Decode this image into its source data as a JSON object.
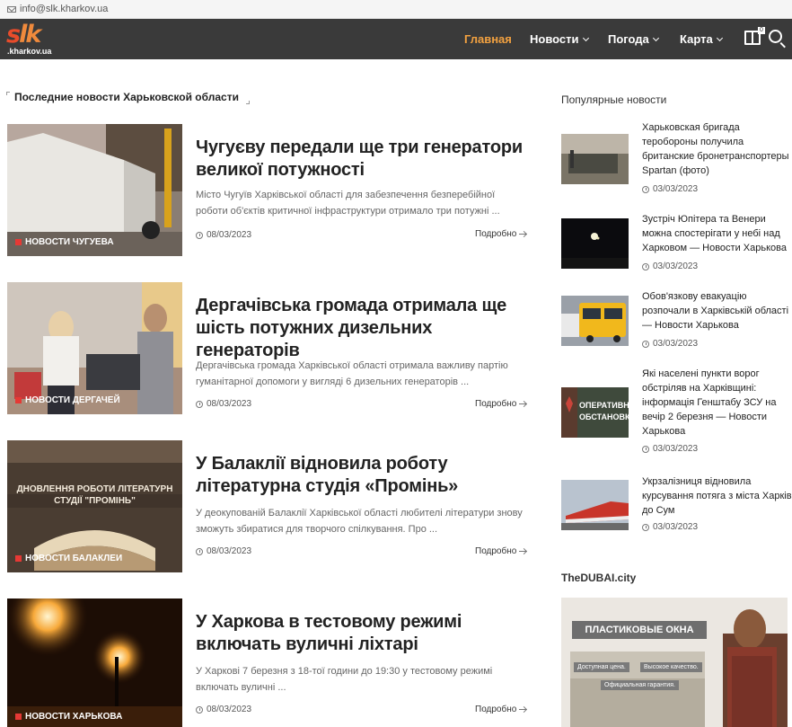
{
  "topbar": {
    "email": "info@slk.kharkov.ua"
  },
  "logo": {
    "main_a": "s",
    "main_b": "lk",
    "domain": ".kharkov.ua"
  },
  "nav": {
    "items": [
      {
        "label": "Главная",
        "active": true
      },
      {
        "label": "Новости",
        "dropdown": true
      },
      {
        "label": "Погода",
        "dropdown": true
      },
      {
        "label": "Карта",
        "dropdown": true
      }
    ],
    "bookmark_badge": "0"
  },
  "main": {
    "section_title": "Последние новости Харьковской области",
    "articles": [
      {
        "category": "НОВОСТИ ЧУГУЕВА",
        "title": "Чугуєву передали ще три генератори великої потужності",
        "excerpt": "Місто Чугуїв Харківської області для забезпечення безперебійної роботи об'єктів критичної інфраструктури отримало три потужні ...",
        "date": "08/03/2023",
        "more": "Подробно"
      },
      {
        "category": "НОВОСТИ ДЕРГАЧЕЙ",
        "title": "Дергачівська громада отримала ще шість потужних дизельних генераторів",
        "excerpt": "Дергачівська громада Харківської області отримала важливу партію гуманітарної допомоги у вигляді 6 дизельних генераторів ...",
        "date": "08/03/2023",
        "more": "Подробно"
      },
      {
        "category": "НОВОСТИ БАЛАКЛЕИ",
        "title": "У Балаклії відновила роботу літературна студія «Промінь»",
        "excerpt": "У деокупованій Балаклії Харківської області любителі літератури знову зможуть збиратися для творчого спілкування. Про ...",
        "date": "08/03/2023",
        "more": "Подробно",
        "image_text": "ДНОВЛЕННЯ РОБОТИ ЛІТЕРАТУРН СТУДІЇ \"ПРОМІНЬ\""
      },
      {
        "category": "НОВОСТИ ХАРЬКОВА",
        "title": "У Харкова в тестовому режимі включать вуличні ліхтарі",
        "excerpt": "У Харкові 7 березня з 18-тої години до 19:30 у тестовому режимі включать вуличні ...",
        "date": "08/03/2023",
        "more": "Подробно"
      }
    ]
  },
  "sidebar": {
    "popular_title": "Популярные новости",
    "popular": [
      {
        "title": "Харьковская бригада теробороны получила британские бронетранспортеры Spartan (фото)",
        "date": "03/03/2023"
      },
      {
        "title": "Зустріч Юпітера та Венери можна спостерігати у небі над Харковом — Новости Харькова",
        "date": "03/03/2023"
      },
      {
        "title": "Обов'язкову евакуацію розпочали в Харківській області — Новости Харькова",
        "date": "03/03/2023"
      },
      {
        "title": "Які населені пункти ворог обстріляв на Харківщині: інформація Генштабу ЗСУ на вечір 2 березня — Новости Харькова",
        "date": "03/03/2023",
        "image_text": "ОПЕРАТИВНА ОБСТАНОВКА"
      },
      {
        "title": "Укрзалізниця відновила курсування потяга з міста Харків до Сум",
        "date": "03/03/2023"
      }
    ],
    "dubai_title": "TheDUBAI.city",
    "ad": {
      "headline": "ПЛАСТИКОВЫЕ ОКНА",
      "tag1": "Доступная цена.",
      "tag2": "Высокое качество.",
      "tag3": "Официальная гарантия."
    }
  }
}
